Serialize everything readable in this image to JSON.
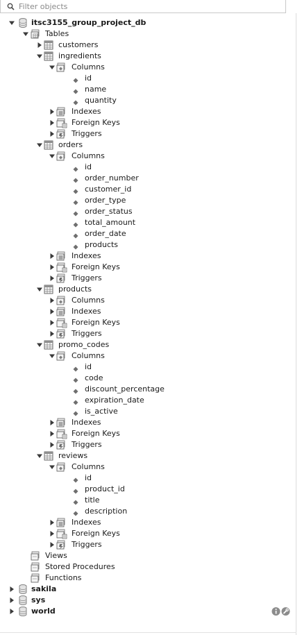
{
  "filter": {
    "placeholder": "Filter objects",
    "value": ""
  },
  "tree": [
    {
      "label": "itsc3155_group_project_db",
      "kind": "db",
      "depth": 0,
      "expanded": true,
      "icon": "database-icon"
    },
    {
      "label": "Tables",
      "kind": "group",
      "depth": 1,
      "expanded": true,
      "icon": "tables-folder-icon"
    },
    {
      "label": "customers",
      "kind": "table",
      "depth": 2,
      "expanded": false,
      "icon": "table-icon"
    },
    {
      "label": "ingredients",
      "kind": "table",
      "depth": 2,
      "expanded": true,
      "icon": "table-icon"
    },
    {
      "label": "Columns",
      "kind": "subgroup",
      "depth": 3,
      "expanded": true,
      "icon": "columns-folder-icon"
    },
    {
      "label": "id",
      "kind": "column",
      "depth": 4,
      "icon": "column-diamond-icon"
    },
    {
      "label": "name",
      "kind": "column",
      "depth": 4,
      "icon": "column-diamond-icon"
    },
    {
      "label": "quantity",
      "kind": "column",
      "depth": 4,
      "icon": "column-diamond-icon"
    },
    {
      "label": "Indexes",
      "kind": "subgroup",
      "depth": 3,
      "expanded": false,
      "icon": "indexes-folder-icon"
    },
    {
      "label": "Foreign Keys",
      "kind": "subgroup",
      "depth": 3,
      "expanded": false,
      "icon": "foreign-keys-folder-icon"
    },
    {
      "label": "Triggers",
      "kind": "subgroup",
      "depth": 3,
      "expanded": false,
      "icon": "triggers-folder-icon"
    },
    {
      "label": "orders",
      "kind": "table",
      "depth": 2,
      "expanded": true,
      "icon": "table-icon"
    },
    {
      "label": "Columns",
      "kind": "subgroup",
      "depth": 3,
      "expanded": true,
      "icon": "columns-folder-icon"
    },
    {
      "label": "id",
      "kind": "column",
      "depth": 4,
      "icon": "column-diamond-icon"
    },
    {
      "label": "order_number",
      "kind": "column",
      "depth": 4,
      "icon": "column-diamond-icon"
    },
    {
      "label": "customer_id",
      "kind": "column",
      "depth": 4,
      "icon": "column-diamond-icon"
    },
    {
      "label": "order_type",
      "kind": "column",
      "depth": 4,
      "icon": "column-diamond-icon"
    },
    {
      "label": "order_status",
      "kind": "column",
      "depth": 4,
      "icon": "column-diamond-icon"
    },
    {
      "label": "total_amount",
      "kind": "column",
      "depth": 4,
      "icon": "column-diamond-icon"
    },
    {
      "label": "order_date",
      "kind": "column",
      "depth": 4,
      "icon": "column-diamond-icon"
    },
    {
      "label": "products",
      "kind": "column",
      "depth": 4,
      "icon": "column-diamond-icon"
    },
    {
      "label": "Indexes",
      "kind": "subgroup",
      "depth": 3,
      "expanded": false,
      "icon": "indexes-folder-icon"
    },
    {
      "label": "Foreign Keys",
      "kind": "subgroup",
      "depth": 3,
      "expanded": false,
      "icon": "foreign-keys-folder-icon"
    },
    {
      "label": "Triggers",
      "kind": "subgroup",
      "depth": 3,
      "expanded": false,
      "icon": "triggers-folder-icon"
    },
    {
      "label": "products",
      "kind": "table",
      "depth": 2,
      "expanded": true,
      "icon": "table-icon"
    },
    {
      "label": "Columns",
      "kind": "subgroup",
      "depth": 3,
      "expanded": false,
      "icon": "columns-folder-icon"
    },
    {
      "label": "Indexes",
      "kind": "subgroup",
      "depth": 3,
      "expanded": false,
      "icon": "indexes-folder-icon"
    },
    {
      "label": "Foreign Keys",
      "kind": "subgroup",
      "depth": 3,
      "expanded": false,
      "icon": "foreign-keys-folder-icon"
    },
    {
      "label": "Triggers",
      "kind": "subgroup",
      "depth": 3,
      "expanded": false,
      "icon": "triggers-folder-icon"
    },
    {
      "label": "promo_codes",
      "kind": "table",
      "depth": 2,
      "expanded": true,
      "icon": "table-icon"
    },
    {
      "label": "Columns",
      "kind": "subgroup",
      "depth": 3,
      "expanded": true,
      "icon": "columns-folder-icon"
    },
    {
      "label": "id",
      "kind": "column",
      "depth": 4,
      "icon": "column-diamond-icon"
    },
    {
      "label": "code",
      "kind": "column",
      "depth": 4,
      "icon": "column-diamond-icon"
    },
    {
      "label": "discount_percentage",
      "kind": "column",
      "depth": 4,
      "icon": "column-diamond-icon"
    },
    {
      "label": "expiration_date",
      "kind": "column",
      "depth": 4,
      "icon": "column-diamond-icon"
    },
    {
      "label": "is_active",
      "kind": "column",
      "depth": 4,
      "icon": "column-diamond-icon"
    },
    {
      "label": "Indexes",
      "kind": "subgroup",
      "depth": 3,
      "expanded": false,
      "icon": "indexes-folder-icon"
    },
    {
      "label": "Foreign Keys",
      "kind": "subgroup",
      "depth": 3,
      "expanded": false,
      "icon": "foreign-keys-folder-icon"
    },
    {
      "label": "Triggers",
      "kind": "subgroup",
      "depth": 3,
      "expanded": false,
      "icon": "triggers-folder-icon"
    },
    {
      "label": "reviews",
      "kind": "table",
      "depth": 2,
      "expanded": true,
      "icon": "table-icon"
    },
    {
      "label": "Columns",
      "kind": "subgroup",
      "depth": 3,
      "expanded": true,
      "icon": "columns-folder-icon"
    },
    {
      "label": "id",
      "kind": "column",
      "depth": 4,
      "icon": "column-diamond-icon"
    },
    {
      "label": "product_id",
      "kind": "column",
      "depth": 4,
      "icon": "column-diamond-icon"
    },
    {
      "label": "title",
      "kind": "column",
      "depth": 4,
      "icon": "column-diamond-icon"
    },
    {
      "label": "description",
      "kind": "column",
      "depth": 4,
      "icon": "column-diamond-icon"
    },
    {
      "label": "Indexes",
      "kind": "subgroup",
      "depth": 3,
      "expanded": false,
      "icon": "indexes-folder-icon"
    },
    {
      "label": "Foreign Keys",
      "kind": "subgroup",
      "depth": 3,
      "expanded": false,
      "icon": "foreign-keys-folder-icon"
    },
    {
      "label": "Triggers",
      "kind": "subgroup",
      "depth": 3,
      "expanded": false,
      "icon": "triggers-folder-icon"
    },
    {
      "label": "Views",
      "kind": "group",
      "depth": 1,
      "expanded": null,
      "icon": "views-folder-icon"
    },
    {
      "label": "Stored Procedures",
      "kind": "group",
      "depth": 1,
      "expanded": null,
      "icon": "procedures-folder-icon"
    },
    {
      "label": "Functions",
      "kind": "group",
      "depth": 1,
      "expanded": null,
      "icon": "functions-folder-icon"
    },
    {
      "label": "sakila",
      "kind": "db",
      "depth": 0,
      "expanded": false,
      "icon": "database-icon"
    },
    {
      "label": "sys",
      "kind": "db",
      "depth": 0,
      "expanded": false,
      "icon": "database-icon"
    },
    {
      "label": "world",
      "kind": "db",
      "depth": 0,
      "expanded": false,
      "icon": "database-icon"
    }
  ],
  "status_icons": [
    "info-icon",
    "wrench-icon"
  ]
}
